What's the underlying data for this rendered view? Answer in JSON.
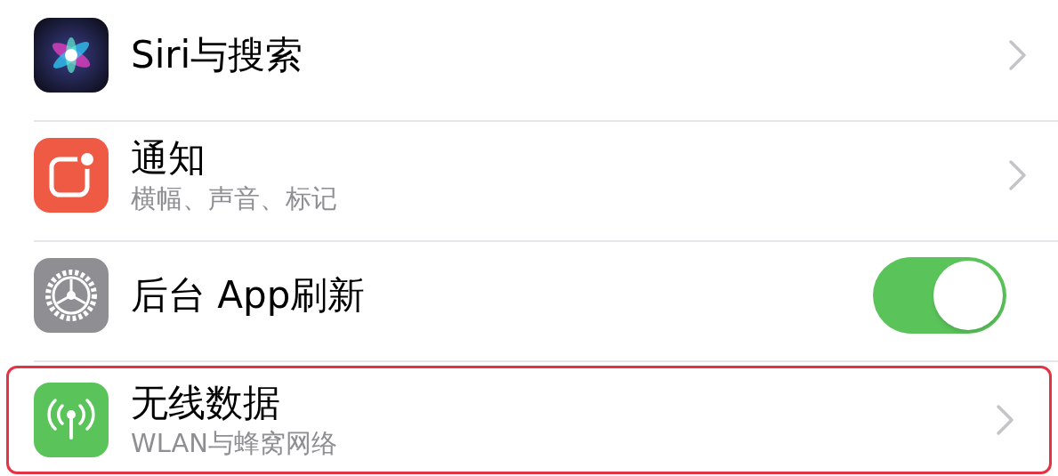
{
  "rows": [
    {
      "kind": "link",
      "title": "Siri与搜索",
      "highlighted": false
    },
    {
      "kind": "link",
      "title": "通知",
      "subtitle": "横幅、声音、标记",
      "highlighted": false
    },
    {
      "kind": "toggle",
      "title": "后台 App刷新",
      "on": true,
      "highlighted": false
    },
    {
      "kind": "link",
      "title": "无线数据",
      "subtitle": "WLAN与蜂窝网络",
      "highlighted": true
    }
  ]
}
